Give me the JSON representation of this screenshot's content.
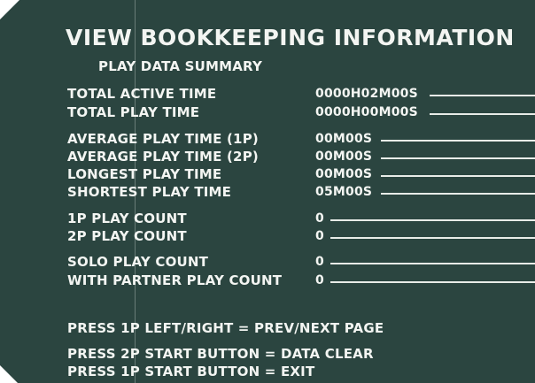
{
  "title": "VIEW BOOKKEEPING INFORMATION",
  "subtitle": "PLAY DATA SUMMARY",
  "rows": [
    {
      "label": "TOTAL ACTIVE TIME",
      "value": "0000H02M00S"
    },
    {
      "label": "TOTAL PLAY TIME",
      "value": "0000H00M00S"
    },
    {
      "label": "AVERAGE PLAY TIME (1P)",
      "value": "00M00S"
    },
    {
      "label": "AVERAGE PLAY TIME (2P)",
      "value": "00M00S"
    },
    {
      "label": "LONGEST PLAY TIME",
      "value": "00M00S"
    },
    {
      "label": "SHORTEST PLAY TIME",
      "value": "05M00S"
    },
    {
      "label": "1P PLAY COUNT",
      "value": "0"
    },
    {
      "label": "2P PLAY COUNT",
      "value": "0"
    },
    {
      "label": "SOLO PLAY COUNT",
      "value": "0"
    },
    {
      "label": "WITH PARTNER PLAY COUNT",
      "value": "0"
    }
  ],
  "instructions": [
    "PRESS 1P LEFT/RIGHT = PREV/NEXT PAGE",
    "PRESS 2P START BUTTON = DATA CLEAR",
    "PRESS 1P START BUTTON = EXIT"
  ],
  "colors": {
    "background": "#2b4540",
    "text": "#f3f5f2"
  }
}
